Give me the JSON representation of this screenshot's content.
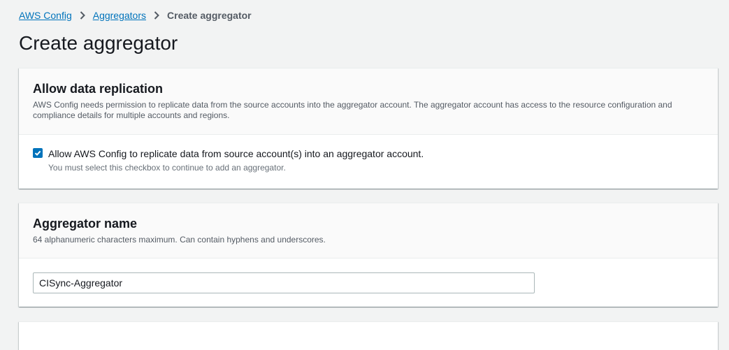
{
  "breadcrumb": {
    "items": [
      {
        "label": "AWS Config"
      },
      {
        "label": "Aggregators"
      }
    ],
    "current": "Create aggregator"
  },
  "page": {
    "title": "Create aggregator"
  },
  "replication_panel": {
    "title": "Allow data replication",
    "description": "AWS Config needs permission to replicate data from the source accounts into the aggregator account. The aggregator account has access to the resource configuration and compliance details for multiple accounts and regions.",
    "checkbox_label": "Allow AWS Config to replicate data from source account(s) into an aggregator account.",
    "checkbox_checked": true,
    "checkbox_help": "You must select this checkbox to continue to add an aggregator."
  },
  "name_panel": {
    "title": "Aggregator name",
    "description": "64 alphanumeric characters maximum. Can contain hyphens and underscores.",
    "input_value": "CISync-Aggregator"
  },
  "colors": {
    "link": "#0073bb",
    "checkbox": "#0073bb",
    "background": "#f2f3f3"
  }
}
